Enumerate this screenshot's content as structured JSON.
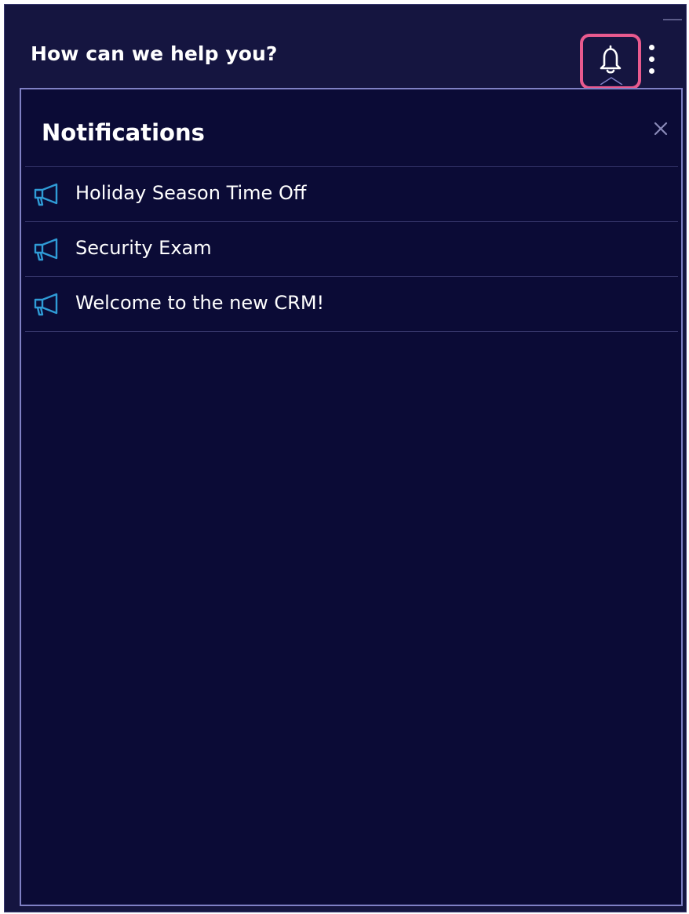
{
  "header": {
    "title": "How can we help you?",
    "bell_icon": "bell-icon",
    "more_icon": "more-vertical-icon",
    "minimize_icon": "minimize-icon",
    "highlight_color": "#e85a8e"
  },
  "notifications": {
    "title": "Notifications",
    "close_icon": "close-icon",
    "item_icon": "megaphone-icon",
    "items": [
      {
        "label": "Holiday Season Time Off"
      },
      {
        "label": "Security Exam"
      },
      {
        "label": "Welcome to the new CRM!"
      }
    ]
  },
  "colors": {
    "window_bg": "#151540",
    "panel_bg": "#0b0b36",
    "panel_border": "#7f80c4",
    "icon_accent": "#2f9bd6"
  }
}
